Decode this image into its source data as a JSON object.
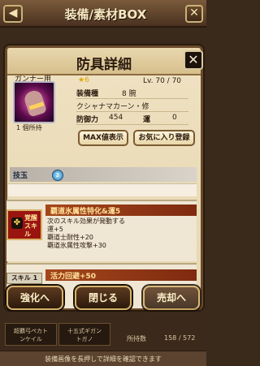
{
  "topbar": {
    "back_icon": "back-arrow-icon",
    "title": "装備/素材BOX",
    "close_icon": "close-icon"
  },
  "dialog": {
    "title": "防具詳細",
    "close_label": "✕",
    "thumb_label": "ガンナー用",
    "owned_text": "1 個所持",
    "rarity": "★6",
    "level": "Lv. 70 / 70",
    "type_label": "装備種",
    "type_value": "8  腕",
    "name": "クシャナマカーン・修",
    "defense_label": "防御力",
    "defense_value": "454",
    "luck_label": "運",
    "luck_value": "0",
    "btn_max": "MAX値表示",
    "btn_fav": "お気に入り登録",
    "slot_label": "技玉",
    "slot_jewel": "2",
    "awake_badge": "覚醒\nスキル",
    "awake_title": "覇道氷属性特化&運5",
    "awake_desc": [
      "次のスキル効果が発動する",
      "運+5",
      "覇道士耐性+20",
      "覇道氷属性攻撃+30"
    ],
    "skill1_badge": "スキル 1",
    "skill1_title": "活力回避+50",
    "skill1_desc": ""
  },
  "actions": {
    "enhance": "強化へ",
    "close": "閉じる",
    "sell": "売却へ"
  },
  "below": {
    "item1": "超覇弓ペカト\nンケイル",
    "item2": "十五式ギガン\nトガノ",
    "count_label": "所持数",
    "count_value": "158 / 572"
  },
  "footer": {
    "hint": "装備画像を長押しで詳細を確認できます"
  }
}
